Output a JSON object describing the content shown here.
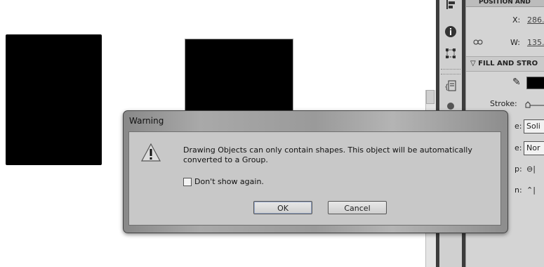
{
  "dialog": {
    "title": "Warning",
    "message": "Drawing Objects can only contain shapes. This object will be automatically converted to a Group.",
    "checkbox_label": "Don't show again.",
    "ok_label": "OK",
    "cancel_label": "Cancel"
  },
  "properties": {
    "position_header": "POSITION AND",
    "x_label": "X:",
    "x_value": "286.",
    "w_label": "W:",
    "w_value": "135.",
    "fill_stroke_header": "FILL AND STRO",
    "stroke_label": "Stroke:",
    "style_label_fragment": "e:",
    "style_value": "Soli",
    "scale_label_fragment": "e:",
    "scale_value": "Nor",
    "cap_label_fragment": "p:",
    "join_label_fragment": "n:"
  },
  "icons": {
    "dock": [
      "align-panel-icon",
      "info-icon",
      "transform-icon",
      "code-snippets-icon",
      "components-icon"
    ],
    "warning": "warning-triangle-icon"
  },
  "colors": {
    "fill": "#000000",
    "dialog_body": "#c8c8c8"
  }
}
